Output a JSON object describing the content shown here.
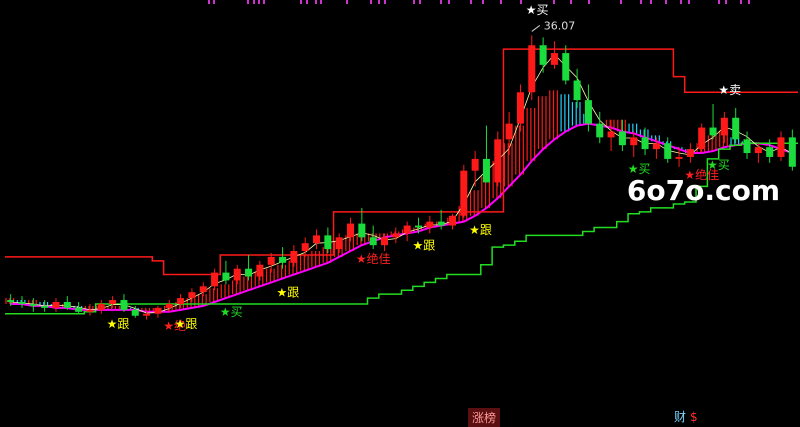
{
  "page": {
    "watermark": "6o7o.com"
  },
  "bottom_tabs": [
    {
      "label": "涨榜"
    },
    {
      "label": "财",
      "suffix": "$"
    }
  ],
  "colors": {
    "background": "#000000",
    "up_candle": "#ff1a1a",
    "down_candle": "#1adc3c",
    "doji": "#ffff00",
    "resistance_line": "#ff1a1a",
    "support_line": "#22dd22",
    "ribbon_upper": "#ff00ff",
    "ribbon_fill_up": "#ff1a1a",
    "ribbon_fill_down": "#22d0ff",
    "ma_line": "#ffffaa",
    "top_marks": "#cc33cc"
  },
  "chart_data": {
    "type": "candlestick",
    "ylim": [
      17.5,
      37.5
    ],
    "high_label": "36.07",
    "candles": [
      [
        22.6,
        22.9,
        22.3,
        22.5
      ],
      [
        22.5,
        22.8,
        22.2,
        22.4
      ],
      [
        22.4,
        22.7,
        22.0,
        22.3
      ],
      [
        22.3,
        22.6,
        22.0,
        22.2
      ],
      [
        22.2,
        22.7,
        22.0,
        22.5
      ],
      [
        22.5,
        22.8,
        22.1,
        22.2
      ],
      [
        22.2,
        22.5,
        21.9,
        22.0
      ],
      [
        22.0,
        22.4,
        21.8,
        22.1
      ],
      [
        22.1,
        22.6,
        21.9,
        22.4
      ],
      [
        22.4,
        22.8,
        22.2,
        22.6
      ],
      [
        22.6,
        22.9,
        22.0,
        22.1
      ],
      [
        22.1,
        22.3,
        21.7,
        21.8
      ],
      [
        21.8,
        22.1,
        21.6,
        21.9
      ],
      [
        21.9,
        22.3,
        21.7,
        22.2
      ],
      [
        22.2,
        22.6,
        22.0,
        22.4
      ],
      [
        22.4,
        22.9,
        22.2,
        22.7
      ],
      [
        22.7,
        23.2,
        22.5,
        23.0
      ],
      [
        23.0,
        23.5,
        22.8,
        23.3
      ],
      [
        23.3,
        24.2,
        23.1,
        24.0
      ],
      [
        24.0,
        24.6,
        23.4,
        23.6
      ],
      [
        23.6,
        24.4,
        23.4,
        24.2
      ],
      [
        24.2,
        24.9,
        23.6,
        23.8
      ],
      [
        23.8,
        24.6,
        23.6,
        24.4
      ],
      [
        24.4,
        25.0,
        24.0,
        24.8
      ],
      [
        24.8,
        25.3,
        24.2,
        24.5
      ],
      [
        24.5,
        25.4,
        24.3,
        25.1
      ],
      [
        25.1,
        25.8,
        24.8,
        25.5
      ],
      [
        25.5,
        26.2,
        25.2,
        25.9
      ],
      [
        25.9,
        26.3,
        25.0,
        25.2
      ],
      [
        25.2,
        26.0,
        25.0,
        25.8
      ],
      [
        25.8,
        26.8,
        25.6,
        26.5
      ],
      [
        26.5,
        27.3,
        25.6,
        25.8
      ],
      [
        25.8,
        26.4,
        25.2,
        25.4
      ],
      [
        25.4,
        26.0,
        25.1,
        25.8
      ],
      [
        25.8,
        26.3,
        25.5,
        26.0
      ],
      [
        26.0,
        26.6,
        25.6,
        26.4
      ],
      [
        26.4,
        26.8,
        26.0,
        26.3
      ],
      [
        26.3,
        26.9,
        26.0,
        26.6
      ],
      [
        26.6,
        27.2,
        26.2,
        26.4
      ],
      [
        26.4,
        27.0,
        26.2,
        26.9
      ],
      [
        26.9,
        29.5,
        26.8,
        29.2
      ],
      [
        29.2,
        30.2,
        28.4,
        29.8
      ],
      [
        29.8,
        31.5,
        29.0,
        28.6
      ],
      [
        28.6,
        31.2,
        28.4,
        30.8
      ],
      [
        30.8,
        32.2,
        30.0,
        31.6
      ],
      [
        31.6,
        33.6,
        31.2,
        33.2
      ],
      [
        33.2,
        36.1,
        32.8,
        35.6
      ],
      [
        35.6,
        36.0,
        34.2,
        34.6
      ],
      [
        34.6,
        35.8,
        34.4,
        35.2
      ],
      [
        35.2,
        35.6,
        33.6,
        33.8
      ],
      [
        33.8,
        34.4,
        32.4,
        32.8
      ],
      [
        32.8,
        33.6,
        31.2,
        31.6
      ],
      [
        31.6,
        32.2,
        30.6,
        30.9
      ],
      [
        30.9,
        31.8,
        30.2,
        31.2
      ],
      [
        31.2,
        31.8,
        30.2,
        30.5
      ],
      [
        30.5,
        31.2,
        29.9,
        30.9
      ],
      [
        30.9,
        31.4,
        30.0,
        30.3
      ],
      [
        30.3,
        30.9,
        29.8,
        30.6
      ],
      [
        30.6,
        30.9,
        29.6,
        29.8
      ],
      [
        29.8,
        30.4,
        29.4,
        29.9
      ],
      [
        29.9,
        30.6,
        29.6,
        30.3
      ],
      [
        30.3,
        31.6,
        30.1,
        31.4
      ],
      [
        31.4,
        32.6,
        30.8,
        31.0
      ],
      [
        31.0,
        32.2,
        30.6,
        31.9
      ],
      [
        31.9,
        32.4,
        30.6,
        30.8
      ],
      [
        30.8,
        31.2,
        29.8,
        30.1
      ],
      [
        30.1,
        30.6,
        29.6,
        30.4
      ],
      [
        30.4,
        30.8,
        29.6,
        29.9
      ],
      [
        29.9,
        31.2,
        29.7,
        30.9
      ],
      [
        30.9,
        31.3,
        29.2,
        29.4
      ]
    ],
    "resistance": [
      24.8,
      24.8,
      24.8,
      24.8,
      24.8,
      24.8,
      24.8,
      24.8,
      24.8,
      24.8,
      24.8,
      24.8,
      24.8,
      24.6,
      23.9,
      23.9,
      23.9,
      23.9,
      23.9,
      24.9,
      24.9,
      24.9,
      24.9,
      24.9,
      24.9,
      24.9,
      24.9,
      24.9,
      24.9,
      27.1,
      27.1,
      27.1,
      27.1,
      27.1,
      27.1,
      27.1,
      27.1,
      27.1,
      27.1,
      27.1,
      27.1,
      27.1,
      27.1,
      27.1,
      35.4,
      35.4,
      35.4,
      35.4,
      35.4,
      35.4,
      35.4,
      35.4,
      35.4,
      35.4,
      35.4,
      35.4,
      35.4,
      35.4,
      35.4,
      34.0,
      33.2,
      33.2,
      33.2,
      33.2,
      33.2,
      33.2,
      33.2,
      33.2,
      33.2,
      33.2
    ],
    "support": [
      21.9,
      21.9,
      21.9,
      21.9,
      21.9,
      21.9,
      21.9,
      22.0,
      22.4,
      22.4,
      22.4,
      22.4,
      22.4,
      22.4,
      22.4,
      22.4,
      22.4,
      22.4,
      22.4,
      22.4,
      22.4,
      22.4,
      22.4,
      22.4,
      22.4,
      22.4,
      22.4,
      22.4,
      22.4,
      22.4,
      22.4,
      22.4,
      22.7,
      22.9,
      22.9,
      23.1,
      23.3,
      23.5,
      23.7,
      23.9,
      23.9,
      23.9,
      24.4,
      25.3,
      25.4,
      25.6,
      25.9,
      25.9,
      25.9,
      25.9,
      25.9,
      26.1,
      26.3,
      26.3,
      26.6,
      27.0,
      27.1,
      27.3,
      27.3,
      27.5,
      27.6,
      28.4,
      29.8,
      30.3,
      30.5,
      30.6,
      30.6,
      30.6,
      30.6,
      30.6
    ],
    "ribbon_lower": [
      22.4,
      22.4,
      22.3,
      22.3,
      22.2,
      22.2,
      22.1,
      22.1,
      22.1,
      22.1,
      22.1,
      22.1,
      22.0,
      22.0,
      22.0,
      22.1,
      22.2,
      22.3,
      22.5,
      22.7,
      22.9,
      23.1,
      23.3,
      23.5,
      23.7,
      23.9,
      24.1,
      24.3,
      24.5,
      24.8,
      25.1,
      25.4,
      25.6,
      25.8,
      25.9,
      26.0,
      26.1,
      26.3,
      26.4,
      26.5,
      26.6,
      26.9,
      27.3,
      27.8,
      28.4,
      29.0,
      29.7,
      30.3,
      30.8,
      31.2,
      31.5,
      31.6,
      31.5,
      31.4,
      31.2,
      31.1,
      30.9,
      30.7,
      30.5,
      30.3,
      30.1,
      30.1,
      30.2,
      30.4,
      30.5,
      30.6,
      30.6,
      30.5,
      30.3,
      30.1
    ],
    "ribbon_upper": [
      22.7,
      22.6,
      22.6,
      22.5,
      22.4,
      22.4,
      22.3,
      22.3,
      22.3,
      22.3,
      22.3,
      22.2,
      22.2,
      22.2,
      22.3,
      22.5,
      22.7,
      22.9,
      23.2,
      23.4,
      23.6,
      23.8,
      24.0,
      24.2,
      24.4,
      24.6,
      24.9,
      25.1,
      25.3,
      25.6,
      25.9,
      26.0,
      26.0,
      26.0,
      26.1,
      26.2,
      26.3,
      26.5,
      26.6,
      26.8,
      27.4,
      28.2,
      28.9,
      29.7,
      30.6,
      31.5,
      32.4,
      33.0,
      33.3,
      33.1,
      32.7,
      32.1,
      31.6,
      31.8,
      31.8,
      31.6,
      31.3,
      31.0,
      30.7,
      30.4,
      30.3,
      30.6,
      31.0,
      31.2,
      30.9,
      30.7,
      30.6,
      30.5,
      30.3,
      30.1
    ],
    "annotations": [
      {
        "index": 9,
        "text": "★跟",
        "color": "#ffff00",
        "pos": "below"
      },
      {
        "index": 14,
        "text": "★绝",
        "color": "#ff2020",
        "pos": "below"
      },
      {
        "index": 15,
        "text": "★跟",
        "color": "#ffff00",
        "pos": "below"
      },
      {
        "index": 19,
        "text": "★买",
        "color": "#22dd22",
        "pos": "below"
      },
      {
        "index": 24,
        "text": "★跟",
        "color": "#ffff00",
        "pos": "below"
      },
      {
        "index": 31,
        "text": "★绝佳",
        "color": "#ff2020",
        "pos": "below"
      },
      {
        "index": 36,
        "text": "★跟",
        "color": "#ffff00",
        "pos": "below"
      },
      {
        "index": 41,
        "text": "★跟",
        "color": "#ffff00",
        "pos": "below"
      },
      {
        "index": 46,
        "text": "★买",
        "color": "#ffffff",
        "pos": "top"
      },
      {
        "index": 55,
        "text": "★买",
        "color": "#22dd22",
        "pos": "below"
      },
      {
        "index": 60,
        "text": "★绝佳",
        "color": "#ff2020",
        "pos": "below"
      },
      {
        "index": 62,
        "text": "★买",
        "color": "#22dd22",
        "pos": "below"
      },
      {
        "index": 63,
        "text": "★卖",
        "color": "#ffffff",
        "pos": "above"
      }
    ]
  }
}
